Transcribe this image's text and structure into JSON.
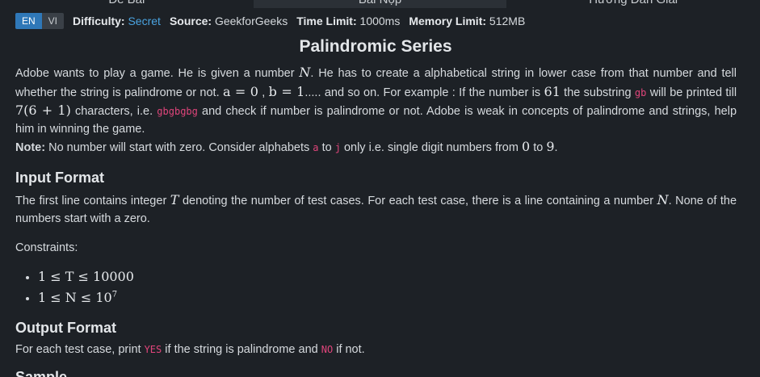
{
  "tabs": [
    "Đề Bài",
    "Bài Nộp",
    "Hướng Dẫn Giải"
  ],
  "lang": {
    "en": "EN",
    "vi": "VI"
  },
  "meta": {
    "difficulty_label": "Difficulty:",
    "difficulty_value": "Secret",
    "source_label": "Source:",
    "source_value": "GeekforGeeks",
    "time_label": "Time Limit:",
    "time_value": "1000ms",
    "memory_label": "Memory Limit:",
    "memory_value": "512MB"
  },
  "title": "Palindromic Series",
  "statement": {
    "s1": "Adobe wants to play a game. He is given a number",
    "m_N": "N",
    "s2": ". He has to create a alphabetical string in lower case from that number and tell whether the string is palindrome or not.",
    "m_a0": "a = 0",
    "s3": ",",
    "m_b1": "b = 1",
    "s4": "..... and so on. For example : If the number is",
    "m_61": "61",
    "s5": "the substring",
    "c_gb": "gb",
    "s6": "will be printed till",
    "m_7": "7(6 + 1)",
    "s7": "characters, i.e.",
    "c_gbgbgbg": "gbgbgbg",
    "s8": "and check if number is palindrome or not. Adobe is weak in concepts of palindrome and strings, help him in winning the game."
  },
  "note": {
    "label": "Note:",
    "s1": "No number will start with zero. Consider alphabets",
    "c_a": "a",
    "s2": "to",
    "c_j": "j",
    "s3": "only i.e. single digit numbers from",
    "m_0": "0",
    "s4": "to",
    "m_9": "9",
    "s5": "."
  },
  "input_format": {
    "heading": "Input Format",
    "s1": "The first line contains integer",
    "m_T": "T",
    "s2": "denoting the number of test cases. For each test case, there is a line containing a number",
    "m_N": "N",
    "s3": ". None of the numbers start with a zero.",
    "constraints_label": "Constraints:",
    "c1": "1 ≤ T ≤ 10000",
    "c2_pre": "1 ≤ N ≤ 10",
    "c2_sup": "7"
  },
  "output_format": {
    "heading": "Output Format",
    "s1": "For each test case, print",
    "c_yes": "YES",
    "s2": "if the string is palindrome and",
    "c_no": "NO",
    "s3": "if not."
  },
  "sample_heading": "Sample"
}
